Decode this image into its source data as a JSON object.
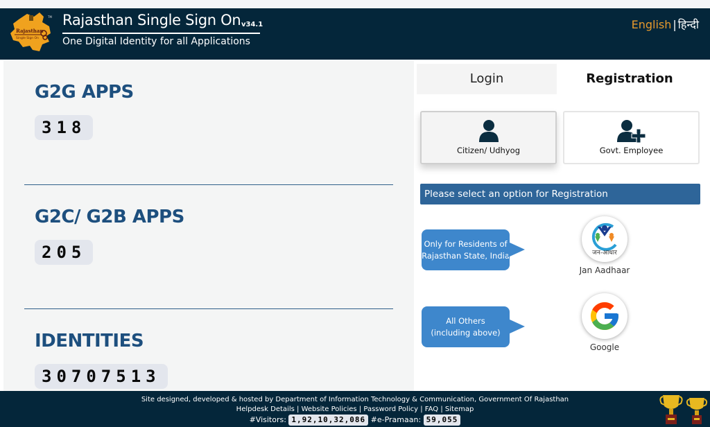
{
  "header": {
    "title": "Rajasthan Single Sign On",
    "version": "v34.1",
    "subtitle": "One Digital Identity for all Applications",
    "logo_text_1": "Rajasthan",
    "logo_text_2": "Single Sign On",
    "lang_english": "English",
    "lang_separator": "|",
    "lang_hindi": "हिन्दी"
  },
  "stats": [
    {
      "title": "G2G APPS",
      "value": "318"
    },
    {
      "title": "G2C/ G2B APPS",
      "value": "205"
    },
    {
      "title": "IDENTITIES",
      "value": "30707513"
    }
  ],
  "tabs": {
    "login": "Login",
    "registration": "Registration",
    "active": "Registration"
  },
  "registration": {
    "options": [
      {
        "label": "Citizen/ Udhyog",
        "icon": "user-icon",
        "selected": true
      },
      {
        "label": "Govt. Employee",
        "icon": "user-plus-icon",
        "selected": false
      }
    ],
    "banner": "Please select an option for Registration",
    "providers": [
      {
        "note": "Only for Residents of Rajasthan State, India",
        "label": "Jan Aadhaar",
        "logo_text": "जन-आधार"
      },
      {
        "note": "All Others (including above)",
        "label": "Google"
      }
    ],
    "notes_lines": [
      [
        "Only for Residents of",
        "Rajasthan State, India"
      ],
      [
        "All Others",
        "(including above)"
      ]
    ]
  },
  "colors": {
    "header_bg": "#04263a",
    "accent_orange": "#e89a2c",
    "stat_title": "#1d4f7e",
    "banner_bg": "#2e6599",
    "bubble_bg": "#3e87cc"
  },
  "footer": {
    "credit": "Site designed, developed & hosted by Department of Information Technology & Communication, Government Of Rajasthan",
    "links": [
      "Helpdesk Details",
      "Website Policies",
      "Password Policy",
      "FAQ",
      "Sitemap"
    ],
    "link_separator": "|",
    "visitors_label": "#Visitors:",
    "visitors_value": "1,92,10,32,086",
    "epramaan_label": "#e-Pramaan:",
    "epramaan_value": "59,055"
  }
}
